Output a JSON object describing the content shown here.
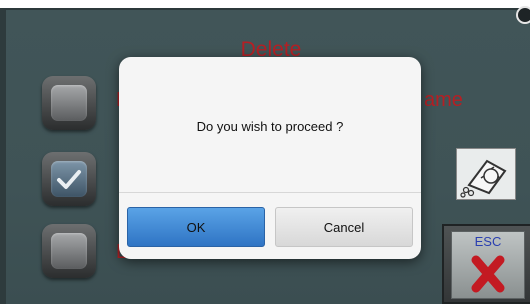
{
  "screen": {
    "title": "Delete",
    "options": [
      {
        "label": "D",
        "hidden_suffix": "ame",
        "checked": false
      },
      {
        "label": "",
        "checked": true
      },
      {
        "label": "L",
        "checked": false
      }
    ]
  },
  "esc_button": {
    "label": "ESC"
  },
  "recycle_icon": {
    "name": "recycle-bin-icon"
  },
  "dialog": {
    "message": "Do you wish to proceed ?",
    "ok_label": "OK",
    "cancel_label": "Cancel"
  },
  "colors": {
    "panel": "#415558",
    "title_red": "#b51f24",
    "ok_blue": "#3a82d1",
    "esc_text": "#2a3fb0",
    "esc_x": "#c31a22"
  }
}
